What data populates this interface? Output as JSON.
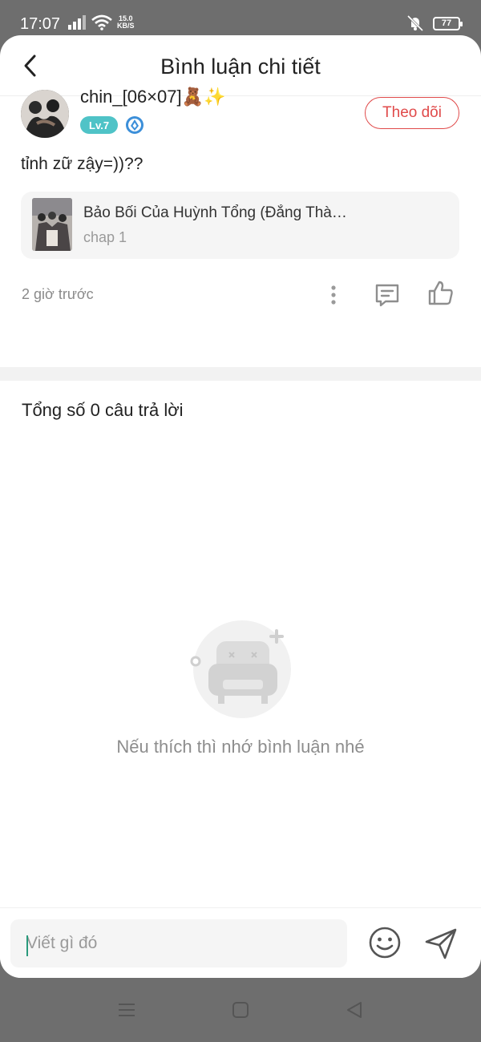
{
  "status_bar": {
    "time": "17:07",
    "speed_value": "15.0",
    "speed_unit": "KB/S",
    "battery": "77",
    "icons": [
      "signal-icon",
      "wifi-icon",
      "mute-vibrate-icon",
      "battery-icon"
    ]
  },
  "header": {
    "title": "Bình luận chi tiết",
    "back_icon": "back-arrow-icon"
  },
  "comment": {
    "user_name": "chin_[06×07]🧸✨",
    "level": "Lv.7",
    "follow_label": "Theo dõi",
    "text": "tỉnh zữ zậy=))??",
    "manga_title": "Bảo Bối Của Huỳnh Tổng (Đẳng Thà…",
    "manga_chapter": "chap 1",
    "time_ago": "2 giờ trước"
  },
  "replies": {
    "count_text": "Tổng số 0 câu trả lời",
    "empty_text": "Nếu thích thì nhớ bình luận nhé"
  },
  "input": {
    "placeholder": "Viết gì đó"
  },
  "colors": {
    "accent_red": "#e04a4a",
    "level_badge": "#4fc3c7",
    "verified_blue": "#3c8fd9"
  }
}
